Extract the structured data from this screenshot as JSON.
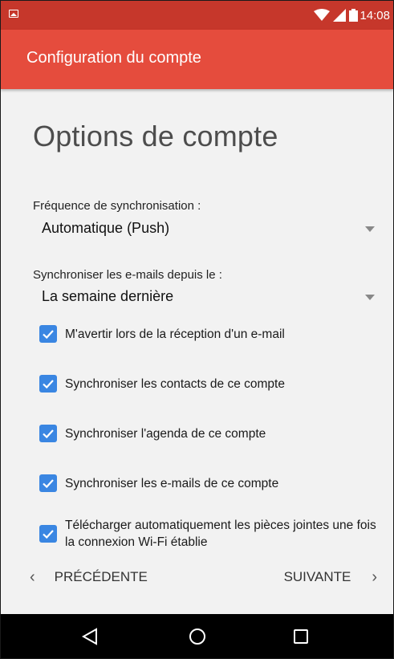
{
  "status_bar": {
    "time": "14:08",
    "icons": [
      "image-notification-icon",
      "wifi-icon",
      "signal-icon",
      "battery-icon"
    ]
  },
  "app_bar": {
    "title": "Configuration du compte"
  },
  "page": {
    "heading": "Options de compte",
    "sync_frequency": {
      "label": "Fréquence de synchronisation :",
      "value": "Automatique (Push)"
    },
    "sync_since": {
      "label": "Synchroniser les e-mails depuis le :",
      "value": "La semaine dernière"
    },
    "options": [
      {
        "label": "M'avertir lors de la réception d'un e-mail",
        "checked": true
      },
      {
        "label": "Synchroniser les contacts de ce compte",
        "checked": true
      },
      {
        "label": "Synchroniser l'agenda de ce compte",
        "checked": true
      },
      {
        "label": "Synchroniser les e-mails de ce compte",
        "checked": true
      },
      {
        "label": "Télécharger automatiquement les pièces jointes une fois la connexion Wi-Fi établie",
        "checked": true
      }
    ]
  },
  "actions": {
    "previous_label": "PRÉCÉDENTE",
    "next_label": "SUIVANTE"
  },
  "colors": {
    "status_bar": "#c6372b",
    "app_bar": "#e54c3d",
    "checkbox": "#3a86e2",
    "background": "#f2f2f2"
  }
}
